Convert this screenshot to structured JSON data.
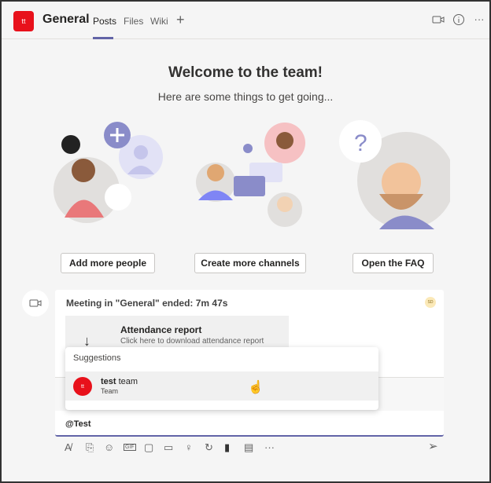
{
  "header": {
    "team_initials": "tt",
    "channel": "General",
    "tabs": [
      "Posts",
      "Files",
      "Wiki"
    ],
    "active_tab": "Posts",
    "icons": [
      "add-tab-icon",
      "video-call-icon",
      "info-icon",
      "more-icon"
    ]
  },
  "welcome": {
    "title": "Welcome to the team!",
    "subtitle": "Here are some things to get going...",
    "buttons": [
      "Add more people",
      "Create more channels",
      "Open the FAQ"
    ]
  },
  "meeting": {
    "title": "Meeting in \"General\" ended: 7m 47s",
    "avatar": "SD",
    "attendance_title": "Attendance report",
    "attendance_desc": "Click here to download attendance report"
  },
  "suggestions": {
    "header": "Suggestions",
    "items": [
      {
        "initials": "tt",
        "name_bold": "test",
        "name_rest": " team",
        "type": "Team"
      }
    ]
  },
  "compose": {
    "value": "@Test",
    "toolbar": [
      "format",
      "attach",
      "emoji",
      "gif",
      "sticker",
      "meet-now",
      "praise",
      "loop",
      "stream",
      "approvals",
      "more",
      "send"
    ]
  },
  "colors": {
    "accent": "#6264a7",
    "team": "#e8111b"
  }
}
